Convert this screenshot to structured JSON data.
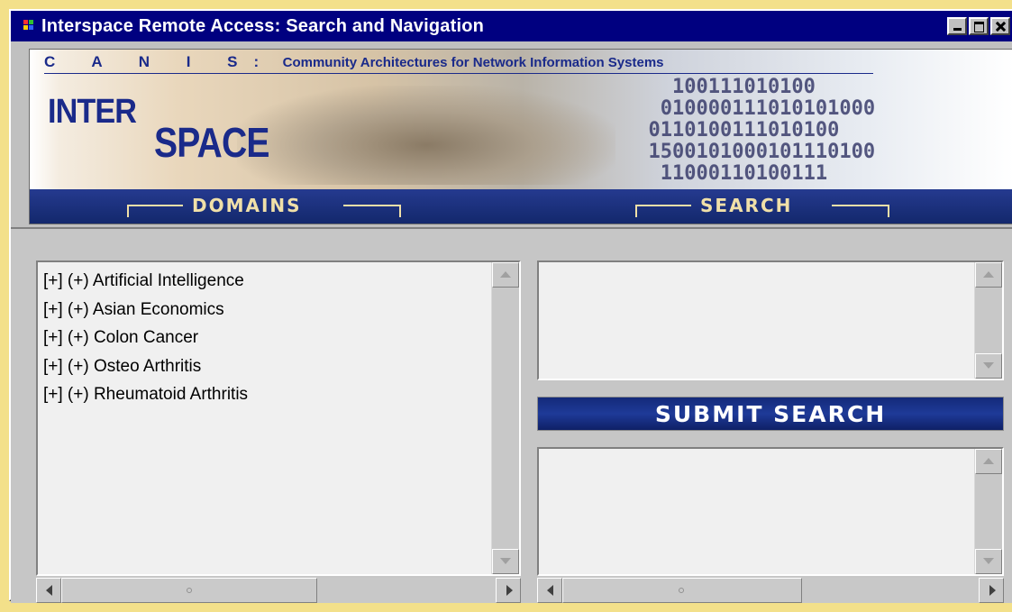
{
  "window": {
    "title": "Interspace Remote Access: Search and Navigation"
  },
  "banner": {
    "canis_letters": "C A N I S:",
    "canis_subtitle": "Community Architectures for Network Information Systems",
    "logo_line1": "INTER",
    "logo_line2": "SPACE",
    "binary_text": "    100111010100\n   010000111010101000\n  0110100111010100\n  1500101000101110100\n   11000110100111",
    "domains_label": "DOMAINS",
    "search_label": "SEARCH"
  },
  "domains": {
    "items": [
      {
        "label": "[+] (+) Artificial Intelligence"
      },
      {
        "label": "[+] (+) Asian Economics"
      },
      {
        "label": "[+] (+) Colon Cancer"
      },
      {
        "label": "[+] (+) Osteo Arthritis"
      },
      {
        "label": "[+] (+) Rheumatoid Arthritis"
      }
    ]
  },
  "search": {
    "query_value": "",
    "submit_label": "SUBMIT SEARCH",
    "results_value": ""
  },
  "colors": {
    "titlebar": "#000080",
    "banner_bar": "#1b2f80",
    "accent_gold": "#f0e0a8",
    "desktop": "#f3e08a"
  }
}
